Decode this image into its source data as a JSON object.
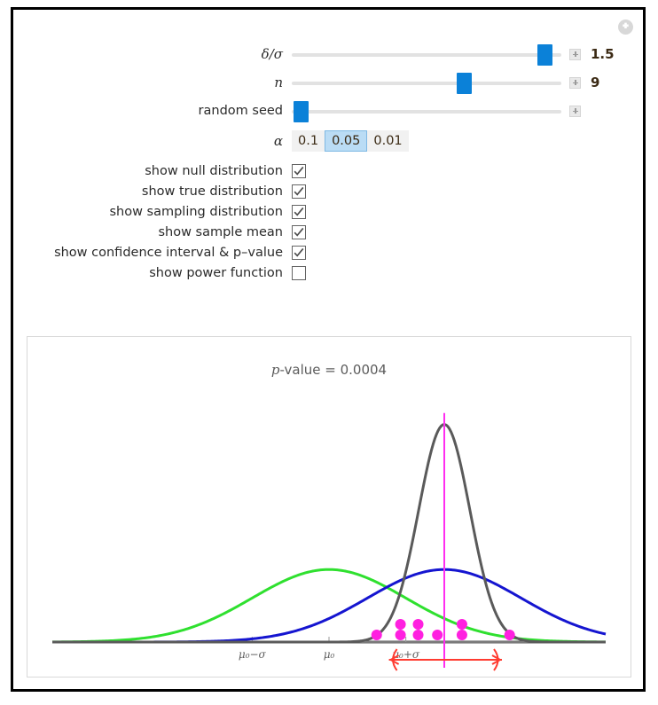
{
  "window": {
    "settings_icon": "plus-circle-icon"
  },
  "controls": {
    "sliders": [
      {
        "label": "δ/σ",
        "value": "1.5",
        "fraction": 0.935,
        "has_value": true,
        "expand_icon": "plus-box-icon"
      },
      {
        "label": "n",
        "value": "9",
        "fraction": 0.63,
        "has_value": true,
        "expand_icon": "plus-box-icon"
      },
      {
        "label": "random seed",
        "value": "",
        "fraction": 0.02,
        "has_value": false,
        "expand_icon": "plus-box-icon"
      }
    ],
    "alpha": {
      "label": "α",
      "options": [
        "0.1",
        "0.05",
        "0.01"
      ],
      "selected": "0.05"
    },
    "checkboxes": [
      {
        "label": "show null distribution",
        "checked": true
      },
      {
        "label": "show true distribution",
        "checked": true
      },
      {
        "label": "show sampling distribution",
        "checked": true
      },
      {
        "label": "show sample mean",
        "checked": true
      },
      {
        "label": "show confidence interval & p–value",
        "checked": true
      },
      {
        "label": "show power function",
        "checked": false
      }
    ]
  },
  "plot": {
    "pvalue_prefix": "p",
    "pvalue_text": "-value = 0.0004",
    "pvalue_full": "p-value = 0.0004"
  },
  "chart_data": {
    "type": "line",
    "title": "p-value = 0.0004",
    "xlabel": "",
    "ylabel": "",
    "grid": false,
    "legend": "none",
    "xlim": [
      -3.6,
      3.6
    ],
    "axis_ticks": [
      {
        "label": "μ₀−σ",
        "x": -1
      },
      {
        "label": "μ₀",
        "x": 0
      },
      {
        "label": "μ₀+σ",
        "x": 1
      }
    ],
    "series": [
      {
        "name": "null distribution",
        "color": "#2fe02f",
        "type": "normal-pdf",
        "mean": 0,
        "sd": 1,
        "peak_height": 0.39
      },
      {
        "name": "true distribution",
        "color": "#1515d0",
        "type": "normal-pdf",
        "mean": 1.5,
        "sd": 1,
        "peak_height": 0.39
      },
      {
        "name": "sampling distribution",
        "color": "#5a5a5a",
        "type": "normal-pdf",
        "mean": 1.5,
        "sd": 0.3333,
        "peak_height": 1.2
      }
    ],
    "annotations": [
      {
        "name": "sample mean line",
        "type": "vline",
        "x": 1.5,
        "color": "#ff2ef0"
      },
      {
        "name": "confidence interval",
        "type": "error-bar",
        "x_low": 0.78,
        "x_high": 2.25,
        "center": 1.5,
        "color": "#ff3b30"
      }
    ],
    "sample_points": {
      "name": "sample data points",
      "color": "#ff20e0",
      "n": 9,
      "x": [
        0.62,
        0.93,
        0.93,
        1.16,
        1.16,
        1.41,
        1.73,
        1.73,
        2.35
      ],
      "jitter_row": [
        0,
        0,
        1,
        0,
        1,
        0,
        0,
        1,
        0
      ]
    }
  }
}
